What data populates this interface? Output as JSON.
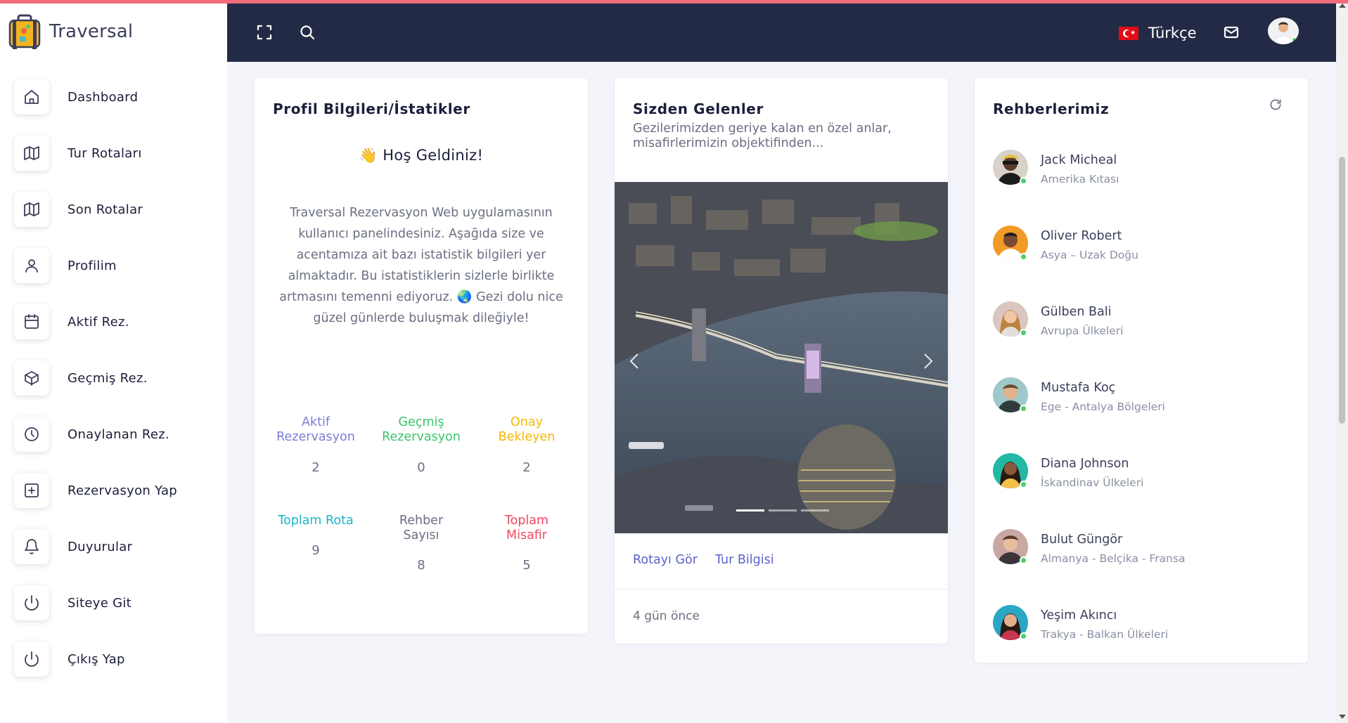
{
  "app": {
    "name": "Traversal"
  },
  "sidebar": {
    "items": [
      {
        "label": "Dashboard",
        "icon": "home-icon"
      },
      {
        "label": "Tur Rotaları",
        "icon": "map-icon"
      },
      {
        "label": "Son Rotalar",
        "icon": "map-icon"
      },
      {
        "label": "Profilim",
        "icon": "user-icon"
      },
      {
        "label": "Aktif Rez.",
        "icon": "calendar-icon"
      },
      {
        "label": "Geçmiş Rez.",
        "icon": "box-icon"
      },
      {
        "label": "Onaylanan Rez.",
        "icon": "clock-icon"
      },
      {
        "label": "Rezervasyon Yap",
        "icon": "plus-square-icon"
      },
      {
        "label": "Duyurular",
        "icon": "bell-icon"
      },
      {
        "label": "Siteye Git",
        "icon": "power-icon"
      },
      {
        "label": "Çıkış Yap",
        "icon": "power-icon"
      }
    ]
  },
  "header": {
    "language": {
      "label": "Türkçe",
      "flag": "turkey-flag-icon"
    },
    "icons": [
      "fullscreen-icon",
      "search-icon",
      "mail-icon"
    ],
    "colors": {
      "background": "#232a45",
      "accent_line": "#f26b7a"
    }
  },
  "profile_card": {
    "title": "Profil Bilgileri/İstatikler",
    "welcome": "👋 Hoş Geldiniz!",
    "description": "Traversal Rezervasyon Web uygulamasının kullanıcı panelindesiniz. Aşağıda size ve acentamıza ait bazı istatistik bilgileri yer almaktadır. Bu istatistiklerin sizlerle birlikte artmasını temenni ediyoruz. 🌏 Gezi dolu nice güzel günlerde buluşmak dileğiyle!",
    "stats": [
      {
        "label": "Aktif Rezervasyon",
        "value": "2",
        "color": "#7c7fd6"
      },
      {
        "label": "Geçmiş Rezervasyon",
        "value": "0",
        "color": "#3cc46a"
      },
      {
        "label": "Onay Bekleyen",
        "value": "2",
        "color": "#f5b800"
      },
      {
        "label": "Toplam Rota",
        "value": "9",
        "color": "#1ab5c9"
      },
      {
        "label": "Rehber Sayısı",
        "value": "8",
        "color": "#6b6f82"
      },
      {
        "label": "Toplam Misafir",
        "value": "5",
        "color": "#f0485e"
      }
    ]
  },
  "gallery_card": {
    "title": "Sizden Gelenler",
    "description": "Gezilerimizden geriye kalan en özel anlar, misafirlerimizin objektifinden...",
    "links": [
      "Rotayı Gör",
      "Tur Bilgisi"
    ],
    "time_ago": "4 gün önce",
    "active_slide": 1,
    "slide_count": 3
  },
  "guides_card": {
    "title": "Rehberlerimiz",
    "guides": [
      {
        "name": "Jack Micheal",
        "region": "Amerika Kıtası"
      },
      {
        "name": "Oliver Robert",
        "region": "Asya – Uzak Doğu"
      },
      {
        "name": "Gülben Bali",
        "region": "Avrupa Ülkeleri"
      },
      {
        "name": "Mustafa Koç",
        "region": "Ege - Antalya Bölgeleri"
      },
      {
        "name": "Diana Johnson",
        "region": "İskandinav Ülkeleri"
      },
      {
        "name": "Bulut Güngör",
        "region": "Almanya - Belçika - Fransa"
      },
      {
        "name": "Yeşim Akıncı",
        "region": "Trakya - Balkan Ülkeleri"
      }
    ]
  }
}
